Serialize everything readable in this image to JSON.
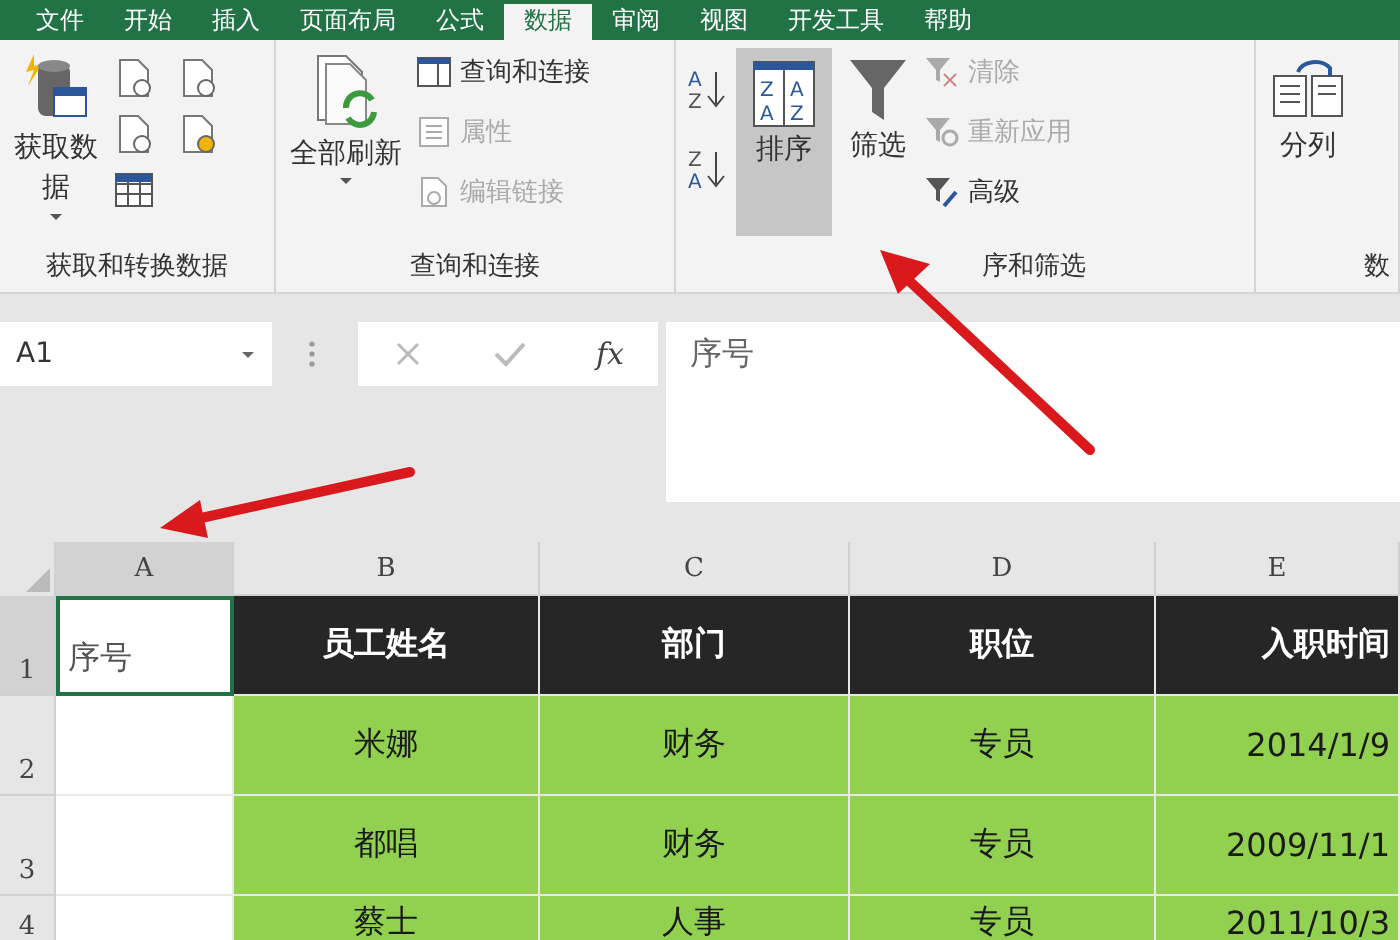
{
  "tabs": [
    {
      "label": "文件",
      "selected": false
    },
    {
      "label": "开始",
      "selected": false
    },
    {
      "label": "插入",
      "selected": false
    },
    {
      "label": "页面布局",
      "selected": false
    },
    {
      "label": "公式",
      "selected": false
    },
    {
      "label": "数据",
      "selected": true
    },
    {
      "label": "审阅",
      "selected": false
    },
    {
      "label": "视图",
      "selected": false
    },
    {
      "label": "开发工具",
      "selected": false
    },
    {
      "label": "帮助",
      "selected": false
    }
  ],
  "ribbon": {
    "get_transform": {
      "get_data": "获取数据",
      "label": "获取和转换数据"
    },
    "queries": {
      "refresh_all": "全部刷新",
      "queries_connections": {
        "label": "查询和连接",
        "disabled": false
      },
      "properties": {
        "label": "属性",
        "disabled": true
      },
      "edit_links": {
        "label": "编辑链接",
        "disabled": true
      },
      "label": "查询和连接"
    },
    "sort_filter": {
      "ascending": [
        "A",
        "Z"
      ],
      "descending": [
        "Z",
        "A"
      ],
      "sort_letters": [
        "Z",
        "A",
        "A",
        "Z"
      ],
      "sort": {
        "label": "排序",
        "selected": true
      },
      "filter": "筛选",
      "clear": {
        "label": "清除",
        "disabled": true
      },
      "reapply": {
        "label": "重新应用",
        "disabled": true
      },
      "advanced": {
        "label": "高级",
        "disabled": false
      },
      "label": "序和筛选"
    },
    "data_tools": {
      "text_to_columns": "分列",
      "label": "数"
    }
  },
  "formula_bar": {
    "name_box": "A1",
    "fx": "fx",
    "formula": "序号"
  },
  "sheet": {
    "columns": [
      {
        "label": "A",
        "selected": true
      },
      {
        "label": "B",
        "selected": false
      },
      {
        "label": "C",
        "selected": false
      },
      {
        "label": "D",
        "selected": false
      },
      {
        "label": "E",
        "selected": false
      }
    ],
    "rows": [
      {
        "number": "1",
        "selected": true,
        "kind": "header",
        "cells": [
          "序号",
          "员工姓名",
          "部门",
          "职位",
          "入职时间"
        ]
      },
      {
        "number": "2",
        "selected": false,
        "kind": "data",
        "cells": [
          "",
          "米娜",
          "财务",
          "专员",
          "2014/1/9"
        ]
      },
      {
        "number": "3",
        "selected": false,
        "kind": "data",
        "cells": [
          "",
          "都唱",
          "财务",
          "专员",
          "2009/11/1"
        ]
      },
      {
        "number": "4",
        "selected": false,
        "kind": "data",
        "cells": [
          "",
          "蔡士",
          "人事",
          "专员",
          "2011/10/3"
        ]
      }
    ]
  }
}
